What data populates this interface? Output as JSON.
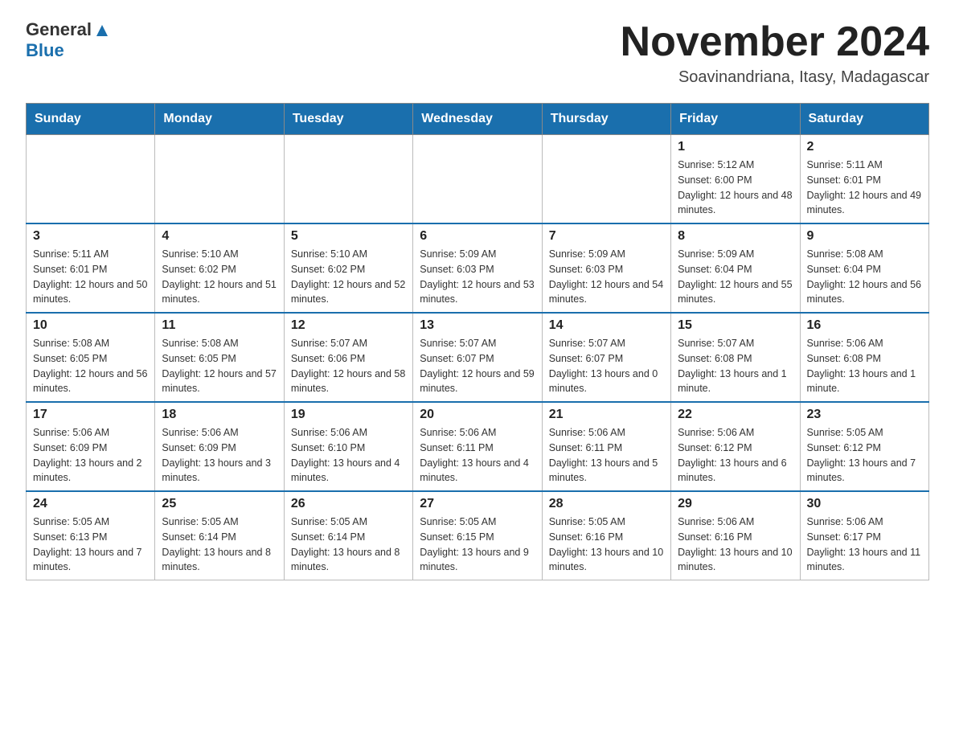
{
  "header": {
    "logo_general": "General",
    "logo_blue": "Blue",
    "month_title": "November 2024",
    "location": "Soavinandriana, Itasy, Madagascar"
  },
  "days_of_week": [
    "Sunday",
    "Monday",
    "Tuesday",
    "Wednesday",
    "Thursday",
    "Friday",
    "Saturday"
  ],
  "weeks": [
    [
      {
        "day": "",
        "info": ""
      },
      {
        "day": "",
        "info": ""
      },
      {
        "day": "",
        "info": ""
      },
      {
        "day": "",
        "info": ""
      },
      {
        "day": "",
        "info": ""
      },
      {
        "day": "1",
        "info": "Sunrise: 5:12 AM\nSunset: 6:00 PM\nDaylight: 12 hours and 48 minutes."
      },
      {
        "day": "2",
        "info": "Sunrise: 5:11 AM\nSunset: 6:01 PM\nDaylight: 12 hours and 49 minutes."
      }
    ],
    [
      {
        "day": "3",
        "info": "Sunrise: 5:11 AM\nSunset: 6:01 PM\nDaylight: 12 hours and 50 minutes."
      },
      {
        "day": "4",
        "info": "Sunrise: 5:10 AM\nSunset: 6:02 PM\nDaylight: 12 hours and 51 minutes."
      },
      {
        "day": "5",
        "info": "Sunrise: 5:10 AM\nSunset: 6:02 PM\nDaylight: 12 hours and 52 minutes."
      },
      {
        "day": "6",
        "info": "Sunrise: 5:09 AM\nSunset: 6:03 PM\nDaylight: 12 hours and 53 minutes."
      },
      {
        "day": "7",
        "info": "Sunrise: 5:09 AM\nSunset: 6:03 PM\nDaylight: 12 hours and 54 minutes."
      },
      {
        "day": "8",
        "info": "Sunrise: 5:09 AM\nSunset: 6:04 PM\nDaylight: 12 hours and 55 minutes."
      },
      {
        "day": "9",
        "info": "Sunrise: 5:08 AM\nSunset: 6:04 PM\nDaylight: 12 hours and 56 minutes."
      }
    ],
    [
      {
        "day": "10",
        "info": "Sunrise: 5:08 AM\nSunset: 6:05 PM\nDaylight: 12 hours and 56 minutes."
      },
      {
        "day": "11",
        "info": "Sunrise: 5:08 AM\nSunset: 6:05 PM\nDaylight: 12 hours and 57 minutes."
      },
      {
        "day": "12",
        "info": "Sunrise: 5:07 AM\nSunset: 6:06 PM\nDaylight: 12 hours and 58 minutes."
      },
      {
        "day": "13",
        "info": "Sunrise: 5:07 AM\nSunset: 6:07 PM\nDaylight: 12 hours and 59 minutes."
      },
      {
        "day": "14",
        "info": "Sunrise: 5:07 AM\nSunset: 6:07 PM\nDaylight: 13 hours and 0 minutes."
      },
      {
        "day": "15",
        "info": "Sunrise: 5:07 AM\nSunset: 6:08 PM\nDaylight: 13 hours and 1 minute."
      },
      {
        "day": "16",
        "info": "Sunrise: 5:06 AM\nSunset: 6:08 PM\nDaylight: 13 hours and 1 minute."
      }
    ],
    [
      {
        "day": "17",
        "info": "Sunrise: 5:06 AM\nSunset: 6:09 PM\nDaylight: 13 hours and 2 minutes."
      },
      {
        "day": "18",
        "info": "Sunrise: 5:06 AM\nSunset: 6:09 PM\nDaylight: 13 hours and 3 minutes."
      },
      {
        "day": "19",
        "info": "Sunrise: 5:06 AM\nSunset: 6:10 PM\nDaylight: 13 hours and 4 minutes."
      },
      {
        "day": "20",
        "info": "Sunrise: 5:06 AM\nSunset: 6:11 PM\nDaylight: 13 hours and 4 minutes."
      },
      {
        "day": "21",
        "info": "Sunrise: 5:06 AM\nSunset: 6:11 PM\nDaylight: 13 hours and 5 minutes."
      },
      {
        "day": "22",
        "info": "Sunrise: 5:06 AM\nSunset: 6:12 PM\nDaylight: 13 hours and 6 minutes."
      },
      {
        "day": "23",
        "info": "Sunrise: 5:05 AM\nSunset: 6:12 PM\nDaylight: 13 hours and 7 minutes."
      }
    ],
    [
      {
        "day": "24",
        "info": "Sunrise: 5:05 AM\nSunset: 6:13 PM\nDaylight: 13 hours and 7 minutes."
      },
      {
        "day": "25",
        "info": "Sunrise: 5:05 AM\nSunset: 6:14 PM\nDaylight: 13 hours and 8 minutes."
      },
      {
        "day": "26",
        "info": "Sunrise: 5:05 AM\nSunset: 6:14 PM\nDaylight: 13 hours and 8 minutes."
      },
      {
        "day": "27",
        "info": "Sunrise: 5:05 AM\nSunset: 6:15 PM\nDaylight: 13 hours and 9 minutes."
      },
      {
        "day": "28",
        "info": "Sunrise: 5:05 AM\nSunset: 6:16 PM\nDaylight: 13 hours and 10 minutes."
      },
      {
        "day": "29",
        "info": "Sunrise: 5:06 AM\nSunset: 6:16 PM\nDaylight: 13 hours and 10 minutes."
      },
      {
        "day": "30",
        "info": "Sunrise: 5:06 AM\nSunset: 6:17 PM\nDaylight: 13 hours and 11 minutes."
      }
    ]
  ]
}
